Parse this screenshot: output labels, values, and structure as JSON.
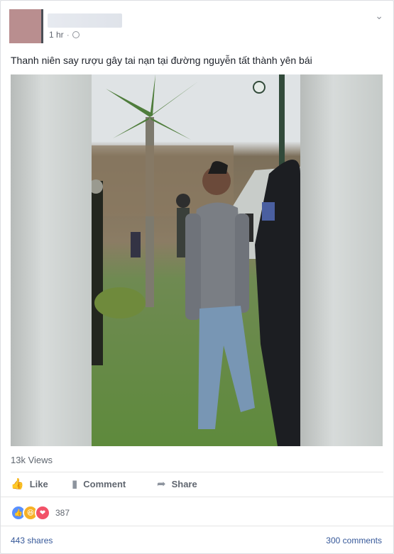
{
  "post": {
    "time": "1 hr",
    "text": "Thanh niên say rượu gây tai nạn tại đường nguyễn tất thành yên bái",
    "privacy_icon": "globe-icon",
    "menu_icon": "chevron-down-icon"
  },
  "video": {
    "views": "13k Views"
  },
  "actions": {
    "like": "Like",
    "comment": "Comment",
    "share": "Share"
  },
  "reactions": {
    "count": "387",
    "types": [
      "like-reaction",
      "haha-reaction",
      "love-reaction"
    ],
    "colors": {
      "like": "#5890ff",
      "haha": "#f7b125",
      "love": "#f25268"
    }
  },
  "footer": {
    "shares": "443 shares",
    "comments": "300 comments"
  }
}
